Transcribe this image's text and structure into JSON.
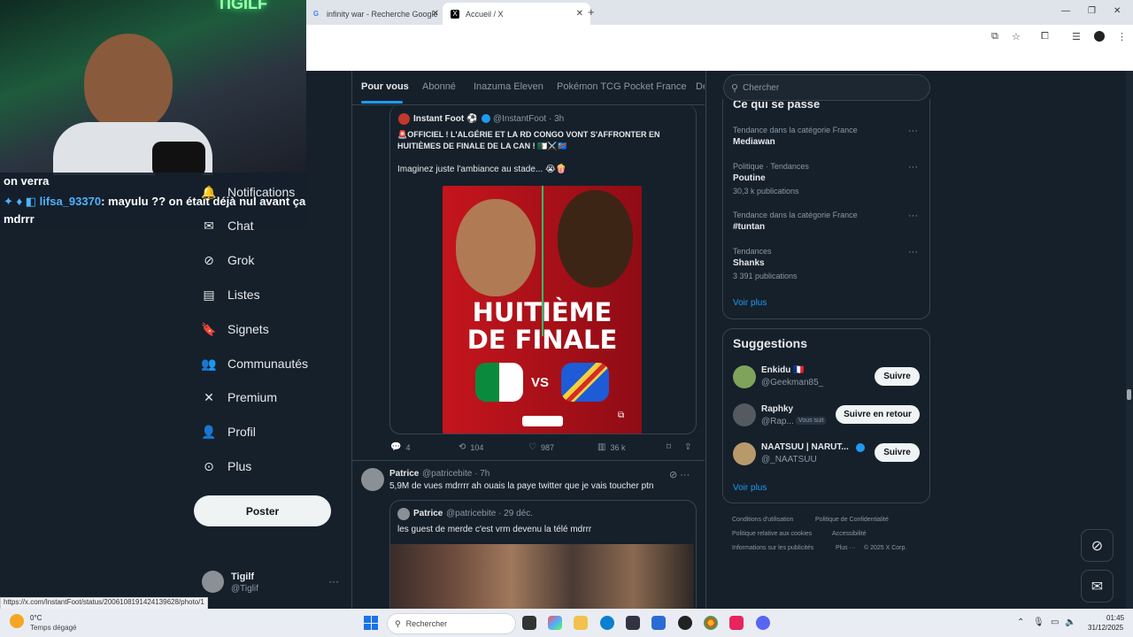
{
  "browser": {
    "tabs": [
      {
        "label": "infinity war - Recherche Google",
        "icon": "google-icon"
      },
      {
        "label": "Accueil / X",
        "icon": "x-logo-icon"
      }
    ],
    "new_tab_symbol": "+",
    "window_controls": [
      "—",
      "❐",
      "✕"
    ]
  },
  "stream": {
    "neon_sign": "TIGILF",
    "chat": [
      {
        "text": "on verra"
      },
      {
        "user": "lifsa_93370",
        "message": ": mayulu ?? on était déjà nul avant ça",
        "continuation": "mdrrr"
      }
    ]
  },
  "sidebar": {
    "items": [
      {
        "label": "Notifications",
        "icon": "bell-icon"
      },
      {
        "label": "Chat",
        "icon": "mail-icon"
      },
      {
        "label": "Grok",
        "icon": "grok-icon"
      },
      {
        "label": "Listes",
        "icon": "list-icon"
      },
      {
        "label": "Signets",
        "icon": "bookmark-icon"
      },
      {
        "label": "Communautés",
        "icon": "people-icon"
      },
      {
        "label": "Premium",
        "icon": "x-logo-icon"
      },
      {
        "label": "Profil",
        "icon": "person-icon"
      },
      {
        "label": "Plus",
        "icon": "more-circle-icon"
      }
    ],
    "post_button": "Poster",
    "account": {
      "name": "Tigilf",
      "handle": "@Tiglif"
    }
  },
  "timeline": {
    "tabs": [
      "Pour vous",
      "Abonné",
      "Inazuma Eleven",
      "Pokémon TCG Pocket France",
      "Dé"
    ],
    "active_tab": "Pour vous",
    "quoted_post": {
      "name": "Instant Foot ⚽",
      "handle": "@InstantFoot · 3h",
      "text_line1": "🚨OFFICIEL ! L'ALGÉRIE ET LA RD CONGO VONT S'AFFRONTER EN",
      "text_line2": "HUITIÈMES DE FINALE DE LA CAN ! 🇩🇿⚔️🇨🇩",
      "text_body": "Imaginez juste l'ambiance au stade... 😭🍿",
      "image_headline_1": "HUITIÈME",
      "image_headline_2": "DE FINALE",
      "image_vs": "VS",
      "stats": {
        "replies": "4",
        "reposts": "104",
        "likes": "987",
        "views": "36 k"
      }
    },
    "post2": {
      "name": "Patrice",
      "handle": "@patricebite · 7h",
      "text": "5,9M de vues mdrrrr ah ouais la paye twitter que je vais toucher ptn",
      "quote": {
        "name": "Patrice",
        "handle": "@patricebite · 29 déc.",
        "text": "les guest de merde c'est vrm devenu la télé mdrrr"
      }
    }
  },
  "right": {
    "search_placeholder": "Chercher",
    "trends_title": "Ce qui se passe",
    "trends": [
      {
        "category": "Tendance dans la catégorie France",
        "name": "Mediawan",
        "count": ""
      },
      {
        "category": "Politique · Tendances",
        "name": "Poutine",
        "count": "30,3 k publications"
      },
      {
        "category": "Tendance dans la catégorie France",
        "name": "#tuntan",
        "count": ""
      },
      {
        "category": "Tendances",
        "name": "Shanks",
        "count": "3 391 publications"
      }
    ],
    "trends_more": "Voir plus",
    "suggestions_title": "Suggestions",
    "suggestions": [
      {
        "name": "Enkidu 🇫🇷",
        "handle": "@Geekman85_",
        "button": "Suivre",
        "badge": ""
      },
      {
        "name": "Raphky",
        "handle": "@Rap...",
        "button": "Suivre en retour",
        "badge": "Vous suit"
      },
      {
        "name": "NAATSUU | NARUT...",
        "handle": "@_NAATSUU",
        "button": "Suivre",
        "badge": ""
      }
    ],
    "suggestions_more": "Voir plus",
    "footer": [
      "Conditions d'utilisation",
      "Politique de Confidentialité",
      "Politique relative aux cookies",
      "Accessibilité",
      "Informations sur les publicités",
      "Plus ···",
      "© 2025 X Corp."
    ]
  },
  "status_url": "https://x.com/InstantFoot/status/2006108191424139628/photo/1",
  "taskbar": {
    "temperature": "0°C",
    "weather": "Temps dégagé",
    "search_placeholder": "Rechercher",
    "time": "01:45",
    "date": "31/12/2025"
  },
  "colors": {
    "accent": "#1d9bf0",
    "background": "#15202b",
    "border": "#38444d"
  }
}
